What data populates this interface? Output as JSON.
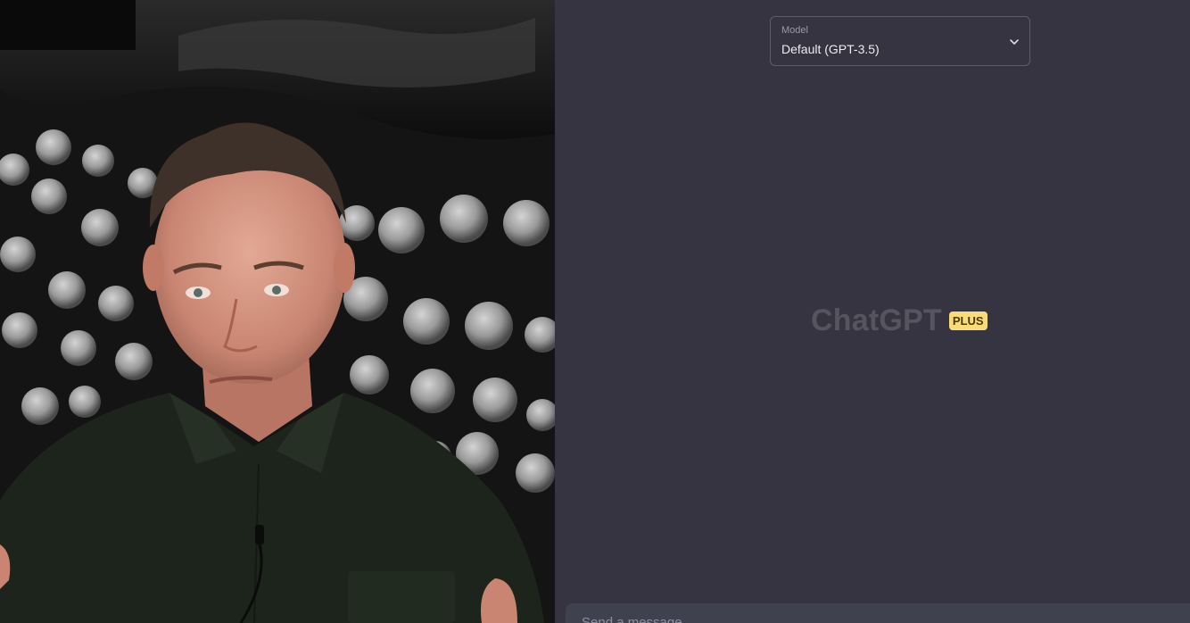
{
  "video": {
    "content": "presenter-webcam-feed"
  },
  "chat": {
    "model_selector": {
      "caption": "Model",
      "value": "Default (GPT-3.5)",
      "icon": "chevron-down-icon"
    },
    "brand": {
      "title": "ChatGPT",
      "badge": "PLUS"
    },
    "composer": {
      "placeholder": "Send a message"
    }
  },
  "colors": {
    "app_background": "#353440",
    "badge_background": "#f9db7a",
    "border": "#5d5c6a"
  }
}
